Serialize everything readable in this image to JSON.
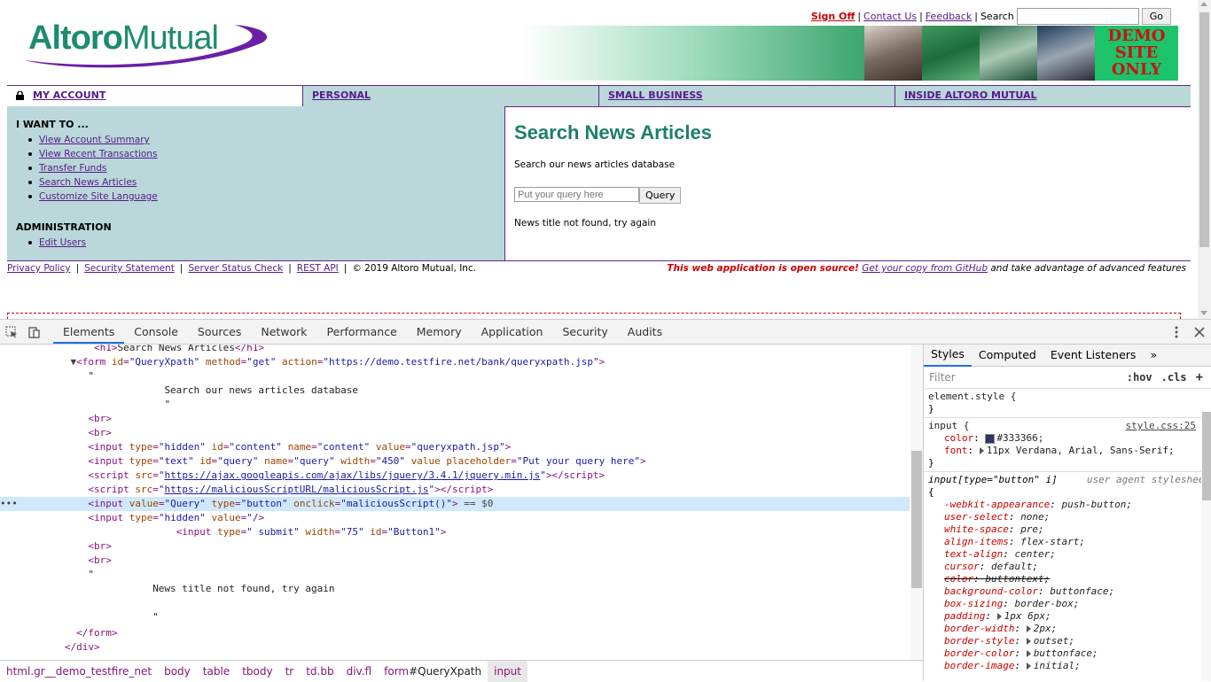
{
  "header": {
    "logo_text_bold": "Altoro",
    "logo_text_rest": "Mutual",
    "sign_off": "Sign Off",
    "contact_us": "Contact Us",
    "feedback": "Feedback",
    "search_label": "Search",
    "go_label": "Go",
    "demo_banner": "DEMO SITE ONLY",
    "sep": "|"
  },
  "nav": {
    "tabs": [
      {
        "label": "MY ACCOUNT"
      },
      {
        "label": "PERSONAL"
      },
      {
        "label": "SMALL BUSINESS"
      },
      {
        "label": "INSIDE ALTORO MUTUAL"
      }
    ]
  },
  "sidebar": {
    "heading": "I WANT TO ...",
    "items": [
      {
        "label": "View Account Summary"
      },
      {
        "label": "View Recent Transactions"
      },
      {
        "label": "Transfer Funds"
      },
      {
        "label": "Search News Articles"
      },
      {
        "label": "Customize Site Language"
      }
    ],
    "admin_heading": "ADMINISTRATION",
    "admin_items": [
      {
        "label": "Edit Users"
      }
    ]
  },
  "main": {
    "title": "Search News Articles",
    "description": "Search our news articles database",
    "query_placeholder": "Put your query here",
    "query_button": "Query",
    "message": "News title not found, try again"
  },
  "footer": {
    "links": [
      "Privacy Policy",
      "Security Statement",
      "Server Status Check",
      "REST API"
    ],
    "copyright": "© 2019 Altoro Mutual, Inc.",
    "open_source": "This web application is open source!",
    "github_link": "Get your copy from GitHub",
    "advanced": " and take advantage of advanced features"
  },
  "devtools": {
    "tabs": [
      "Elements",
      "Console",
      "Sources",
      "Network",
      "Performance",
      "Memory",
      "Application",
      "Security",
      "Audits"
    ],
    "active_tab": "Elements",
    "breadcrumbs": [
      "html.gr__demo_testfire_net",
      "body",
      "table",
      "tbody",
      "tr",
      "td.bb",
      "div.fl",
      "form",
      "input"
    ],
    "breadcrumb_form_id": "#QueryXpath",
    "styles_tabs": [
      "Styles",
      "Computed",
      "Event Listeners",
      "»"
    ],
    "filter_placeholder": "Filter",
    "hov": ":hov",
    "cls": ".cls",
    "element_style": "element.style {",
    "close_brace": "}",
    "input_selector": "input {",
    "input_source": "style.css:25",
    "input_props": [
      {
        "name": "color",
        "value": "#333366;"
      },
      {
        "name": "font",
        "value": "11px Verdana, Arial, Sans-Serif;"
      }
    ],
    "ua_selector": "input[type=\"button\" i]",
    "ua_source": "user agent stylesheet",
    "ua_open": "{",
    "ua_props": [
      {
        "name": "-webkit-appearance",
        "value": "push-button;"
      },
      {
        "name": "user-select",
        "value": "none;"
      },
      {
        "name": "white-space",
        "value": "pre;"
      },
      {
        "name": "align-items",
        "value": "flex-start;"
      },
      {
        "name": "text-align",
        "value": "center;"
      },
      {
        "name": "cursor",
        "value": "default;"
      },
      {
        "name": "color",
        "value": "buttontext;"
      },
      {
        "name": "background-color",
        "value": "buttonface;"
      },
      {
        "name": "box-sizing",
        "value": "border-box;"
      },
      {
        "name": "padding",
        "value": "1px 6px;"
      },
      {
        "name": "border-width",
        "value": "2px;"
      },
      {
        "name": "border-style",
        "value": "outset;"
      },
      {
        "name": "border-color",
        "value": "buttonface;"
      },
      {
        "name": "border-image",
        "value": "initial;"
      }
    ],
    "dom": {
      "h1_open": "<h1>",
      "h1_text": "Search News Articles",
      "h1_close": "</h1>",
      "form_action": "https://demo.testfire.net/bank/queryxpath.jsp",
      "text_quote": "\"",
      "text_desc": "Search our news articles database",
      "br": "<br>",
      "hidden_value": "queryxpath.jsp",
      "placeholder": "Put your query here",
      "jquery_src": "https://ajax.googleapis.com/ajax/libs/jquery/3.4.1/jquery.min.js",
      "malicious_src": "https://maliciousScriptURL/maliciousScript.js",
      "query_value": "Query",
      "onclick": "maliciousScript()",
      "sel_marker": " == $0",
      "msg": "News title not found, try again",
      "form_close": "</form>",
      "div_close": "</div>",
      "dots": "•••"
    }
  },
  "colors": {
    "brand_green": "#1d8b6f",
    "nav_bg": "#bad7d9",
    "border_purple": "#5c2a8c",
    "link_red": "#cc0000",
    "selection": "#cfe8fc"
  }
}
